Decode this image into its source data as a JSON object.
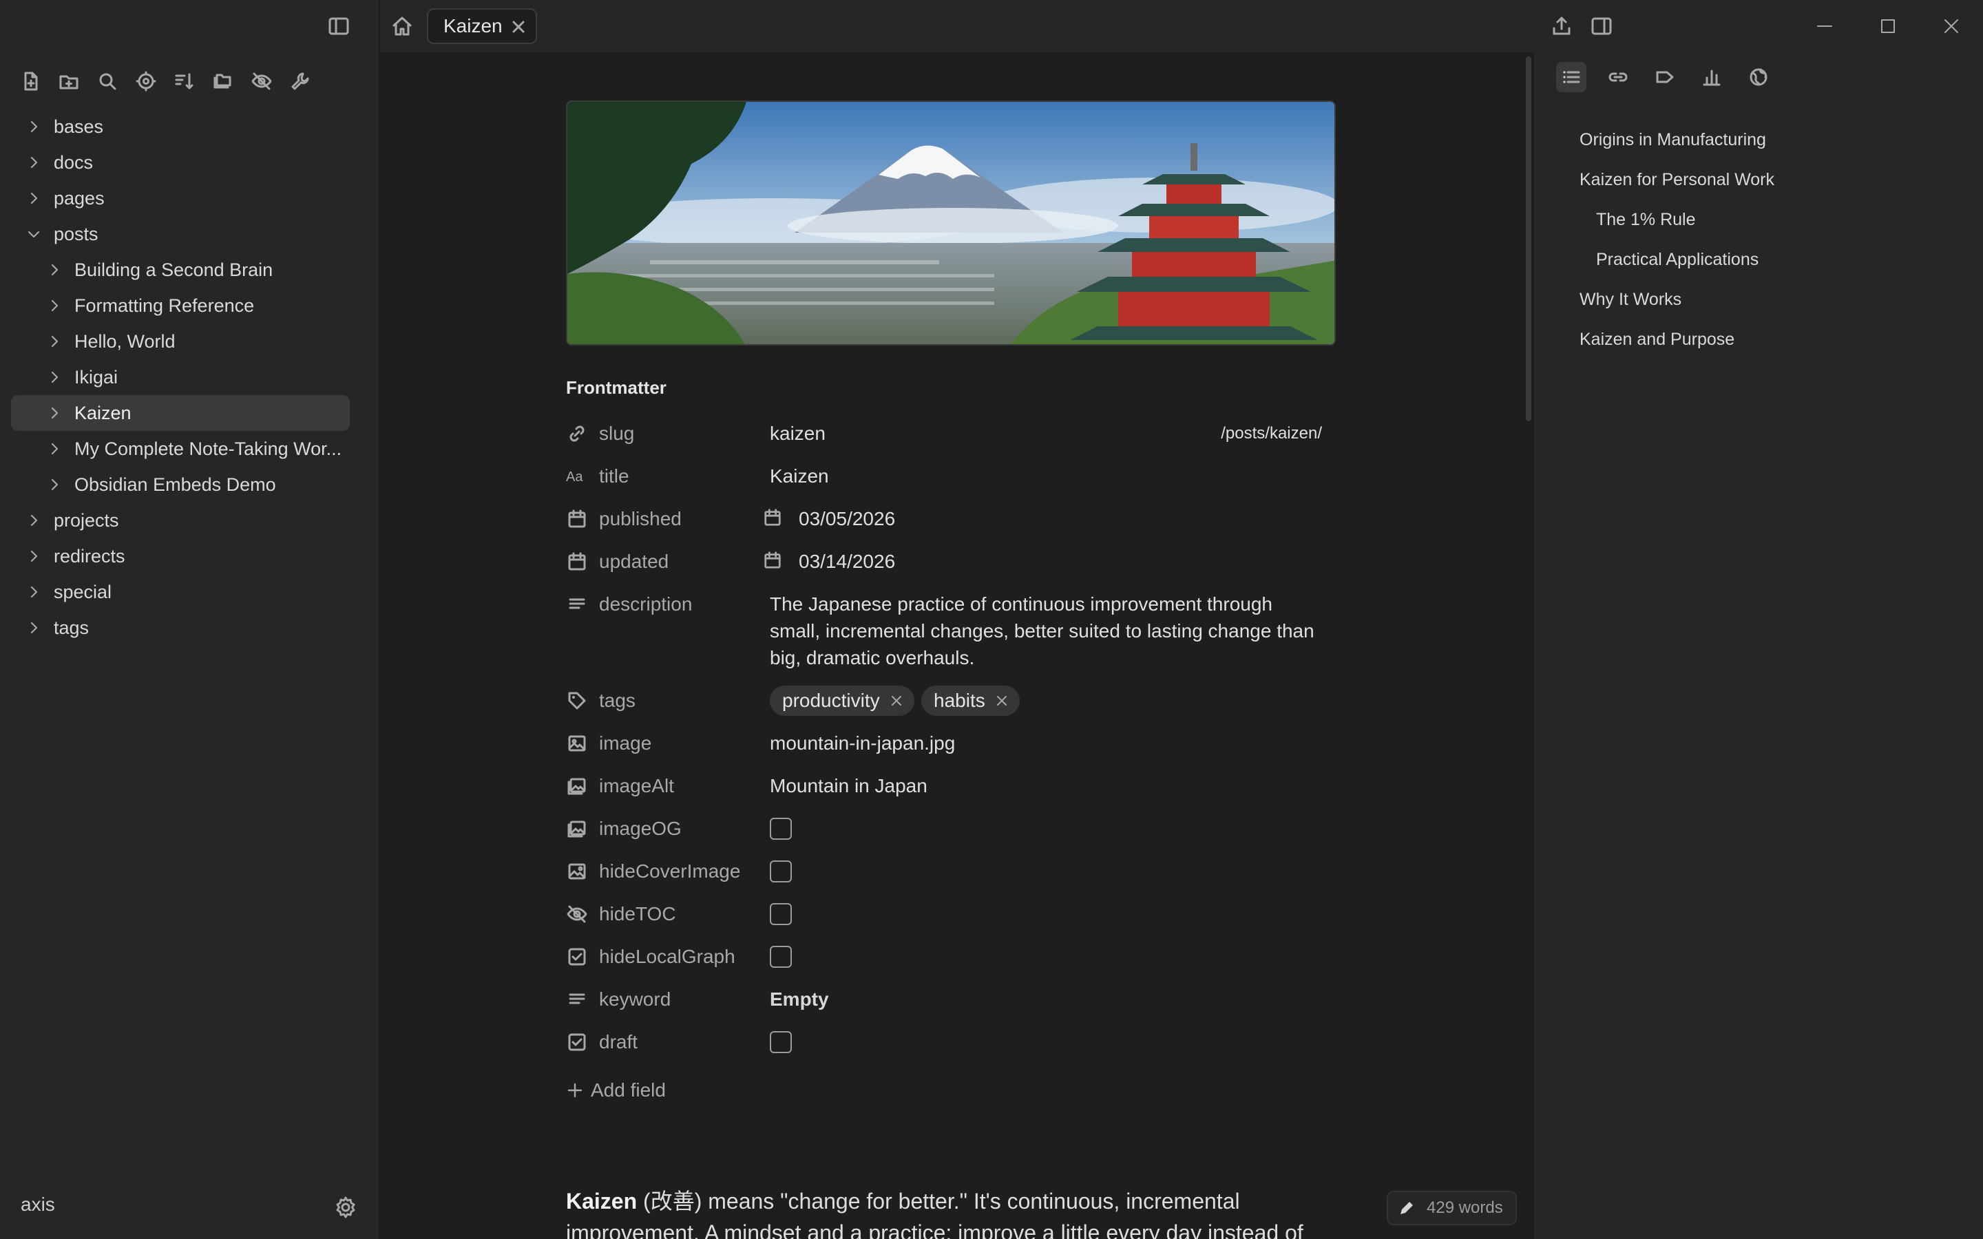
{
  "app": {
    "vault_name": "axis"
  },
  "tabs": [
    {
      "label": "Kaizen"
    }
  ],
  "file_tree": [
    {
      "label": "bases",
      "level": 0,
      "expanded": false
    },
    {
      "label": "docs",
      "level": 0,
      "expanded": false
    },
    {
      "label": "pages",
      "level": 0,
      "expanded": false
    },
    {
      "label": "posts",
      "level": 0,
      "expanded": true
    },
    {
      "label": "Building a Second Brain",
      "level": 1,
      "expanded": false
    },
    {
      "label": "Formatting Reference",
      "level": 1,
      "expanded": false
    },
    {
      "label": "Hello, World",
      "level": 1,
      "expanded": false
    },
    {
      "label": "Ikigai",
      "level": 1,
      "expanded": false
    },
    {
      "label": "Kaizen",
      "level": 1,
      "expanded": false,
      "active": true
    },
    {
      "label": "My Complete Note-Taking Wor...",
      "level": 1,
      "expanded": false
    },
    {
      "label": "Obsidian Embeds Demo",
      "level": 1,
      "expanded": false
    },
    {
      "label": "projects",
      "level": 0,
      "expanded": false
    },
    {
      "label": "redirects",
      "level": 0,
      "expanded": false
    },
    {
      "label": "special",
      "level": 0,
      "expanded": false
    },
    {
      "label": "tags",
      "level": 0,
      "expanded": false
    }
  ],
  "frontmatter": {
    "heading": "Frontmatter",
    "slug": {
      "key": "slug",
      "value": "kaizen",
      "url": "/posts/kaizen/"
    },
    "title": {
      "key": "title",
      "value": "Kaizen"
    },
    "published": {
      "key": "published",
      "value": "03/05/2026"
    },
    "updated": {
      "key": "updated",
      "value": "03/14/2026"
    },
    "description": {
      "key": "description",
      "value": "The Japanese practice of continuous improvement through small, incremental changes, better suited to lasting change than big, dramatic overhauls."
    },
    "tags": {
      "key": "tags",
      "values": [
        "productivity",
        "habits"
      ]
    },
    "image": {
      "key": "image",
      "value": "mountain-in-japan.jpg"
    },
    "imageAlt": {
      "key": "imageAlt",
      "value": "Mountain in Japan"
    },
    "imageOG": {
      "key": "imageOG",
      "checked": false
    },
    "hideCoverImage": {
      "key": "hideCoverImage",
      "checked": false
    },
    "hideTOC": {
      "key": "hideTOC",
      "checked": false
    },
    "hideLocalGraph": {
      "key": "hideLocalGraph",
      "checked": false
    },
    "keyword": {
      "key": "keyword",
      "value": "Empty"
    },
    "draft": {
      "key": "draft",
      "checked": false
    },
    "add_field_label": "Add field"
  },
  "body": {
    "term": "Kaizen",
    "rest": " (改善) means \"change for better.\" It's continuous, incremental improvement. A mindset and a practice: improve a little every day instead of"
  },
  "status": {
    "word_count": "429 words"
  },
  "outline": [
    {
      "label": "Origins in Manufacturing",
      "level": 1
    },
    {
      "label": "Kaizen for Personal Work",
      "level": 1
    },
    {
      "label": "The 1% Rule",
      "level": 2
    },
    {
      "label": "Practical Applications",
      "level": 2
    },
    {
      "label": "Why It Works",
      "level": 1
    },
    {
      "label": "Kaizen and Purpose",
      "level": 1
    }
  ],
  "icons": {
    "left_toolbar": [
      "new-note-icon",
      "new-folder-icon",
      "search-icon",
      "graph-icon",
      "sort-icon",
      "collapse-folders-icon",
      "hide-icon",
      "wrench-icon"
    ],
    "right_tabs": [
      "outline-icon",
      "backlinks-icon",
      "tags-icon",
      "stats-icon",
      "globe-icon"
    ]
  },
  "colors": {
    "background": "#1e1e1e",
    "sidebar": "#262626",
    "active_item": "#3a3a3a",
    "text": "#dadada",
    "muted": "#a9a9a9"
  }
}
